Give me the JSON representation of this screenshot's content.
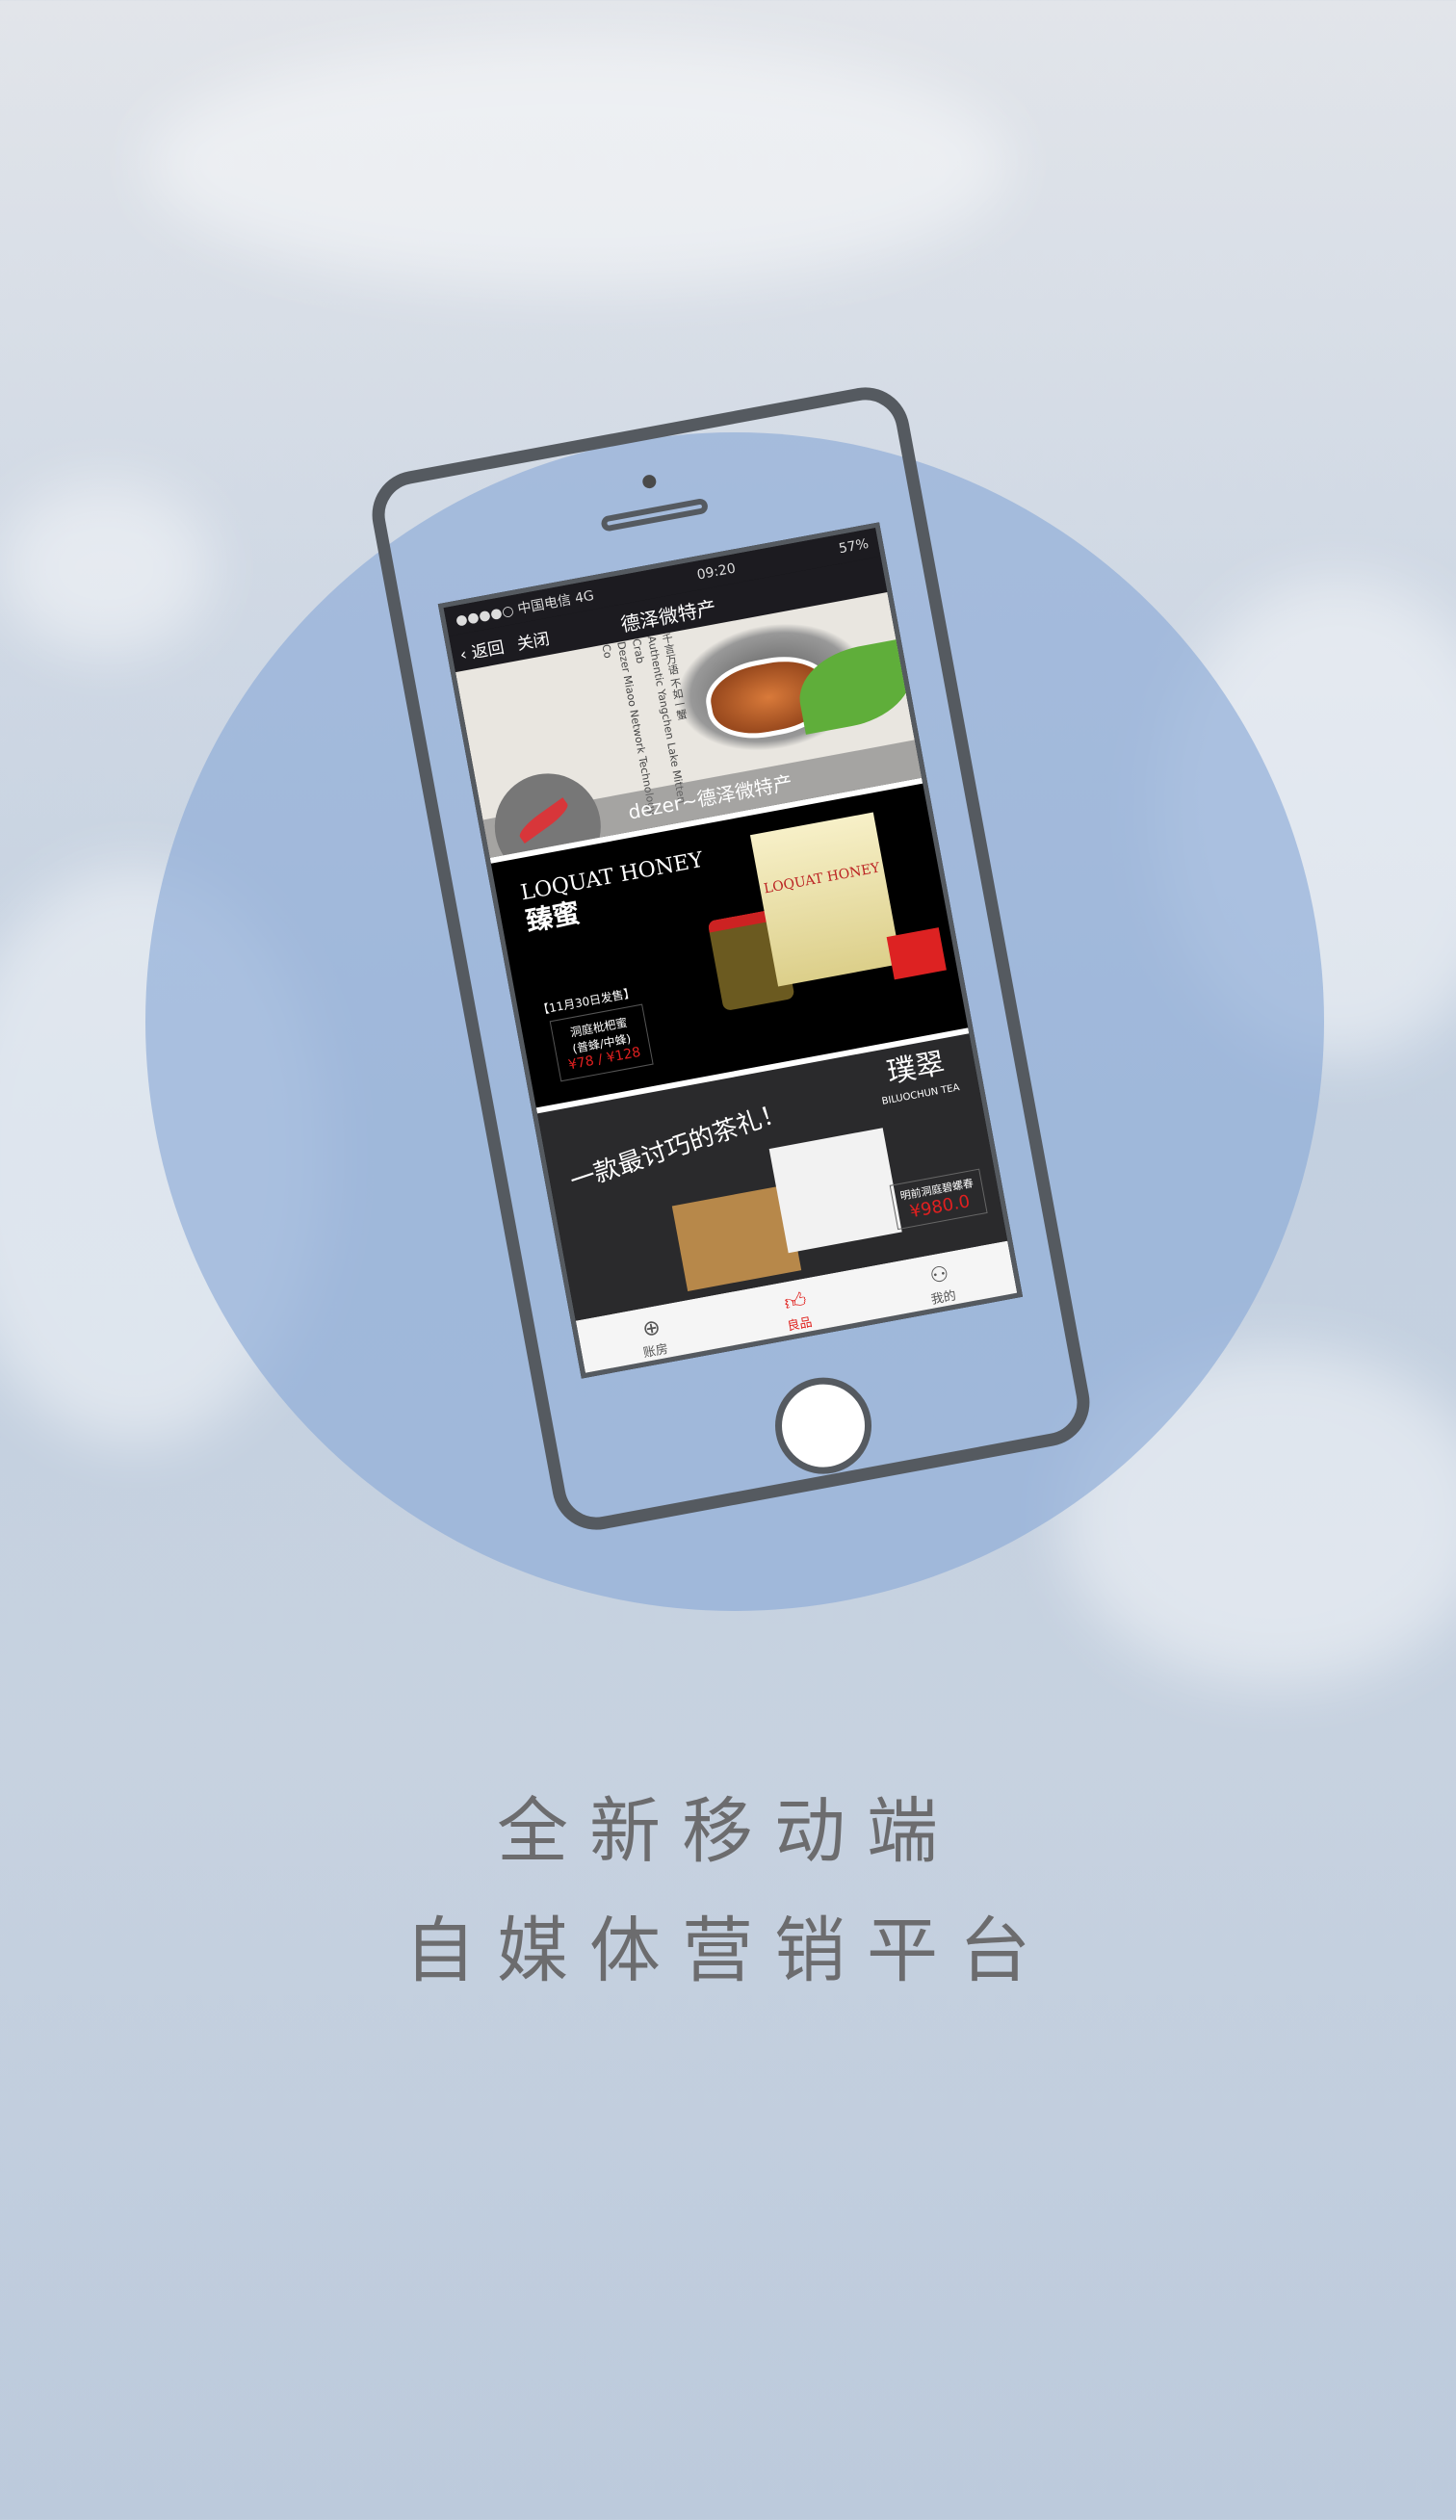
{
  "phone": {
    "status": {
      "carrier": "●●●●○ 中国电信 4G",
      "time": "09:20",
      "battery": "57%"
    },
    "nav": {
      "back": "返回",
      "close": "关闭",
      "title": "德泽微特产"
    },
    "banner1": {
      "caption": "dezer~德泽微特产",
      "vertical_text": [
        "千言万语 不如一蟹",
        "Authentic Yangchen Lake Mitten Crab",
        "Dezer Miaoo Network Technology Co"
      ]
    },
    "banner2": {
      "brand": "LOQUAT HONEY",
      "brand_cn": "臻蜜",
      "date": "【11月30日发售】",
      "product": "洞庭枇杷蜜",
      "product_sub": "(普蜂/中蜂)",
      "price": "¥78 / ¥128"
    },
    "banner3": {
      "slogan": "一款最讨巧的茶礼！",
      "logo_cn": "璞翠",
      "logo_en": "BILUOCHUN TEA",
      "product": "明前洞庭碧螺春",
      "price": "¥980.0"
    },
    "tabs": [
      {
        "label": "账房",
        "icon": "ledger-icon"
      },
      {
        "label": "良品",
        "icon": "thumbs-up-icon",
        "active": true
      },
      {
        "label": "我的",
        "icon": "user-icon"
      }
    ],
    "accent": "#e0221e"
  },
  "headline": {
    "line1": "全新移动端",
    "line2": "自媒体营销平台"
  }
}
